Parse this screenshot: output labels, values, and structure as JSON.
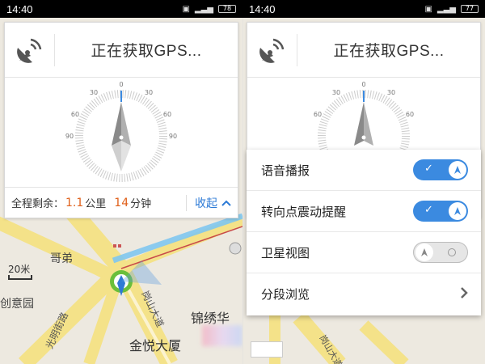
{
  "status_bar": {
    "time": "14:40",
    "battery_left": "78",
    "battery_right": "77"
  },
  "panel": {
    "title": "正在获取GPS...",
    "compass_ticks": [
      "0",
      "30",
      "30",
      "60",
      "60",
      "90",
      "90"
    ],
    "remaining_label": "全程剩余：",
    "distance_value": "1.1",
    "distance_unit": "公里",
    "time_value": "14",
    "time_unit": "分钟",
    "collapse_label": "收起"
  },
  "map": {
    "labels": [
      "哥弟",
      "创意园",
      "锦绣华",
      "金悦大厦"
    ],
    "roads": [
      "光明街路",
      "岗山大道",
      "岗山大道"
    ],
    "scale_label": "20米"
  },
  "menu": {
    "items": [
      {
        "label": "语音播报",
        "state": "on"
      },
      {
        "label": "转向点震动提醒",
        "state": "on"
      },
      {
        "label": "卫星视图",
        "state": "off"
      },
      {
        "label": "分段浏览",
        "state": "chevron"
      }
    ]
  },
  "colors": {
    "accent": "#3b8ae0",
    "highlight": "#e0601a",
    "road": "#f7e79a"
  },
  "icons": [
    "gps-satellite-icon",
    "chevron-up-icon",
    "chevron-right-icon",
    "navigation-arrow-icon"
  ]
}
